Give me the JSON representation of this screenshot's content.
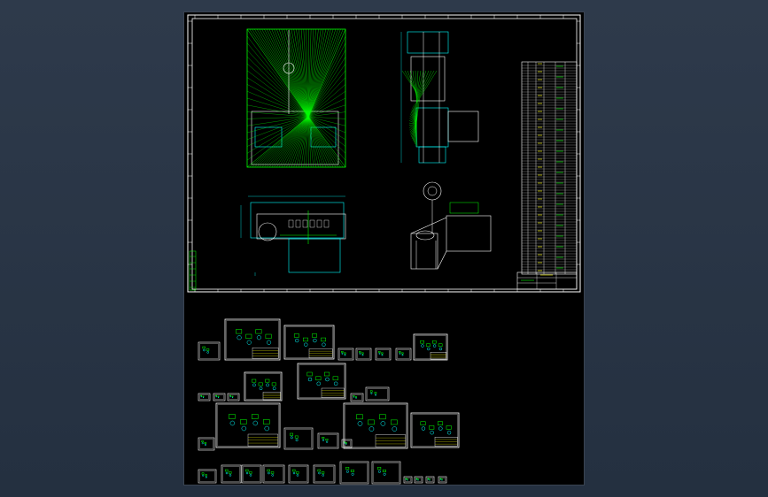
{
  "viewer": {
    "background_color": "#2b3645",
    "canvas_color": "#000000",
    "colors": {
      "frame": "#ffffff",
      "line_green": "#00ff00",
      "line_cyan": "#00ffff",
      "line_white": "#ffffff",
      "text_yellow": "#ffff00"
    }
  },
  "main_sheet": {
    "views": [
      {
        "name": "front-view",
        "icon": "machine-front-view-icon"
      },
      {
        "name": "side-view",
        "icon": "machine-side-view-icon"
      },
      {
        "name": "top-view",
        "icon": "machine-top-view-icon"
      },
      {
        "name": "isometric-view",
        "icon": "machine-isometric-view-icon"
      }
    ],
    "bom_table": {
      "icon": "parts-list-table-icon"
    },
    "title_block": {
      "icon": "title-block-icon"
    }
  },
  "sub_sheets": [
    {
      "row": 1,
      "count": 9
    },
    {
      "row": 2,
      "count": 6
    },
    {
      "row": 3,
      "count": 8
    },
    {
      "row": 4,
      "count": 12
    }
  ]
}
